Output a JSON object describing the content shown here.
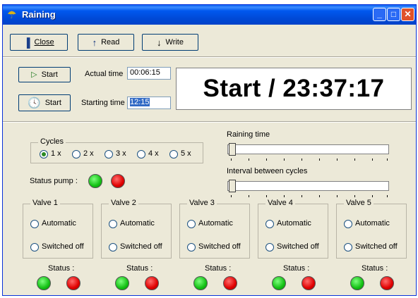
{
  "window": {
    "title": "Raining"
  },
  "titlebar": {
    "minimize_glyph": "_",
    "maximize_glyph": "□",
    "close_glyph": "✕"
  },
  "toolbar": {
    "close_label": "Close",
    "read_label": "Read",
    "write_label": "Write"
  },
  "timing": {
    "start_actual_label": "Start",
    "actual_time_label": "Actual time",
    "actual_time_value": "00:06:15",
    "start_timed_label": "Start",
    "starting_time_label": "Starting time",
    "starting_time_value": "12:15",
    "display_text": "Start / 23:37:17"
  },
  "cycles": {
    "title": "Cycles",
    "options": [
      "1 x",
      "2 x",
      "3 x",
      "4 x",
      "5 x"
    ],
    "selected": "1 x"
  },
  "sliders": {
    "raining_time_label": "Raining time",
    "interval_label": "Interval between cycles"
  },
  "pump": {
    "label": "Status pump :"
  },
  "valves": [
    {
      "title": "Valve 1",
      "automatic_label": "Automatic",
      "off_label": "Switched off",
      "status_label": "Status :"
    },
    {
      "title": "Valve 2",
      "automatic_label": "Automatic",
      "off_label": "Switched off",
      "status_label": "Status :"
    },
    {
      "title": "Valve 3",
      "automatic_label": "Automatic",
      "off_label": "Switched off",
      "status_label": "Status :"
    },
    {
      "title": "Valve 4",
      "automatic_label": "Automatic",
      "off_label": "Switched off",
      "status_label": "Status :"
    },
    {
      "title": "Valve 5",
      "automatic_label": "Automatic",
      "off_label": "Switched off",
      "status_label": "Status :"
    }
  ],
  "icons": {
    "app": "umbrella-icon",
    "close": "door-icon",
    "read": "arrow-up-icon",
    "write": "arrow-down-icon",
    "play": "play-icon",
    "clock": "clock-icon"
  },
  "colors": {
    "title_bar": "#0054e3",
    "status_on": "#13c013",
    "status_off": "#e00000"
  }
}
